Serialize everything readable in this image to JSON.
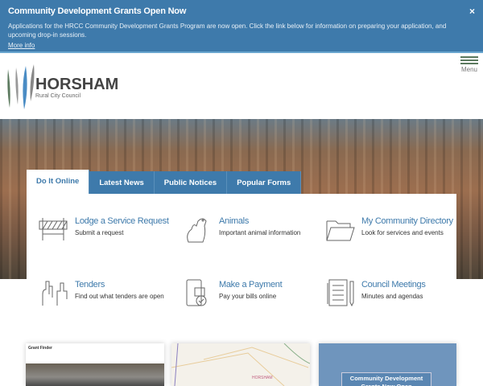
{
  "banner": {
    "title": "Community Development Grants Open Now",
    "text": "Applications for the HRCC Community Development Grants Program are now open. Click the link below for information on preparing your application, and upcoming drop-in sessions.",
    "link": "More info",
    "close": "×"
  },
  "logo": {
    "name": "HORSHAM",
    "sub": "Rural City Council"
  },
  "menu": {
    "label": "Menu"
  },
  "tabs": [
    "Do It Online",
    "Latest News",
    "Public Notices",
    "Popular Forms"
  ],
  "items": [
    {
      "title": "Lodge a Service Request",
      "desc": "Submit a request",
      "icon": "barrier-icon"
    },
    {
      "title": "Animals",
      "desc": "Important animal information",
      "icon": "dog-cat-icon"
    },
    {
      "title": "My Community Directory",
      "desc": "Look for services and events",
      "icon": "folder-icon"
    },
    {
      "title": "Tenders",
      "desc": "Find out what tenders are open",
      "icon": "raised-hands-icon"
    },
    {
      "title": "Make a Payment",
      "desc": "Pay your bills online",
      "icon": "payment-icon"
    },
    {
      "title": "Council Meetings",
      "desc": "Minutes and agendas",
      "icon": "notebook-icon"
    }
  ],
  "cards": [
    {
      "label": "Grant Finder"
    },
    {
      "label": "HORSHAM"
    },
    {
      "label": "Community Development Grants Now Open"
    }
  ]
}
